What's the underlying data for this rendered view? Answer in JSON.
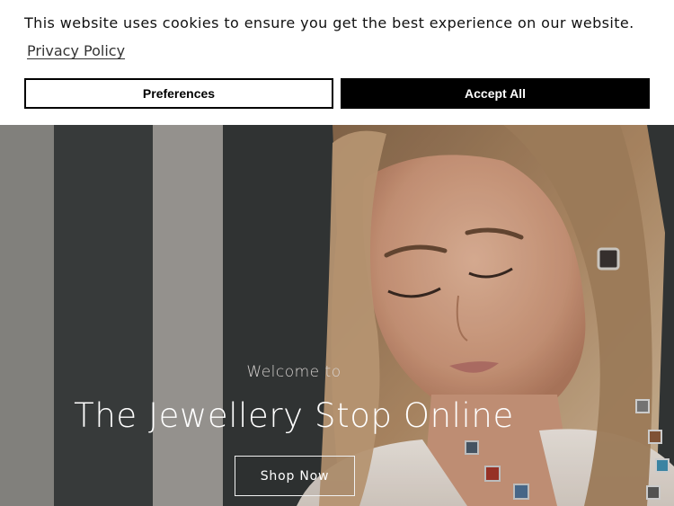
{
  "cookie_banner": {
    "message": "This website uses cookies to ensure you get the best experience on our website.",
    "privacy_link": "Privacy Policy",
    "preferences_button": "Preferences",
    "accept_button": "Accept All"
  },
  "hero": {
    "welcome": "Welcome to",
    "title": "The Jewellery Stop Online",
    "cta": "Shop Now"
  },
  "colors": {
    "accent_button_bg": "#000000",
    "hero_text": "#ffffff"
  }
}
